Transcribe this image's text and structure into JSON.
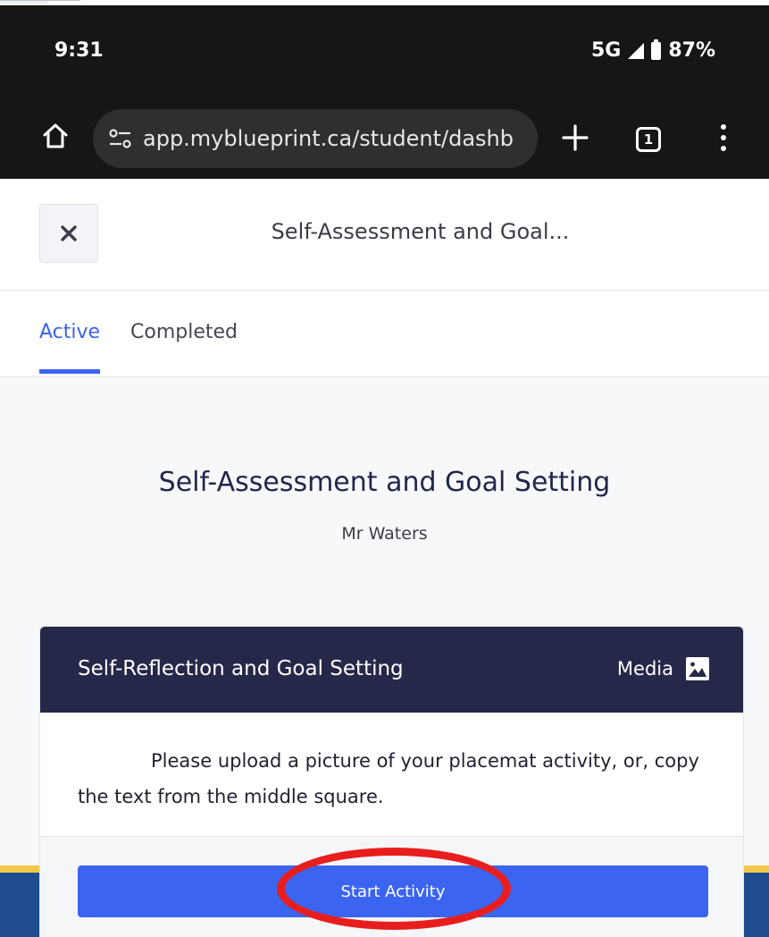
{
  "status_bar": {
    "time": "9:31",
    "network": "5G",
    "battery": "87%"
  },
  "browser": {
    "url": "app.myblueprint.ca/student/dashb",
    "tab_count": "1",
    "icons": [
      "home-icon",
      "site-settings-icon",
      "new-tab-icon",
      "tabs-icon",
      "more-menu-icon"
    ]
  },
  "header": {
    "title": "Self-Assessment and Goal..."
  },
  "tabs": [
    {
      "label": "Active",
      "selected": true
    },
    {
      "label": "Completed",
      "selected": false
    }
  ],
  "main": {
    "title": "Self-Assessment and Goal Setting",
    "teacher": "Mr Waters"
  },
  "activity_card": {
    "title": "Self-Reflection and Goal Setting",
    "type_label": "Media",
    "instructions": "Please upload a picture of your placemat activity, or, copy the text from the middle square.",
    "button_label": "Start Activity"
  },
  "colors": {
    "accent_blue": "#3b64f1",
    "card_header_navy": "#252848",
    "annotation_red": "#e81e1e",
    "browser_chrome": "#161616"
  }
}
